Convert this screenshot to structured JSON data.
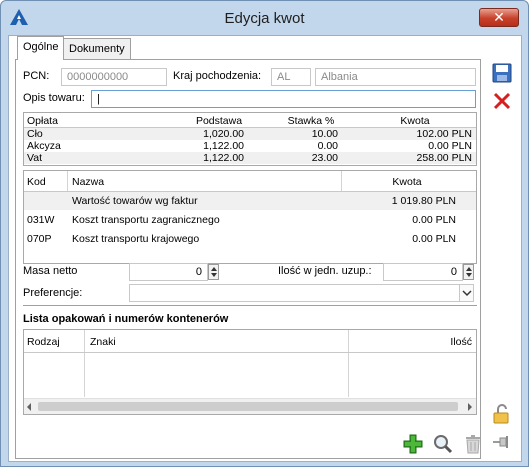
{
  "window": {
    "title": "Edycja kwot",
    "close_label": "✕"
  },
  "tabs": [
    {
      "label": "Ogólne",
      "active": true
    },
    {
      "label": "Dokumenty",
      "active": false
    }
  ],
  "form": {
    "pcn_label": "PCN:",
    "pcn_value": "0000000000",
    "country_label": "Kraj pochodzenia:",
    "country_code": "AL",
    "country_name": "Albania",
    "description_label": "Opis towaru:",
    "description_value": "|"
  },
  "fees": {
    "headers": [
      "Opłata",
      "Podstawa",
      "Stawka %",
      "Kwota"
    ],
    "rows": [
      {
        "name": "Cło",
        "base": "1,020.00",
        "rate": "10.00",
        "amount": "102.00 PLN"
      },
      {
        "name": "Akcyza",
        "base": "1,122.00",
        "rate": "0.00",
        "amount": "0.00 PLN"
      },
      {
        "name": "Vat",
        "base": "1,122.00",
        "rate": "23.00",
        "amount": "258.00 PLN"
      }
    ]
  },
  "costs": {
    "headers": [
      "Kod",
      "Nazwa",
      "Kwota"
    ],
    "rows": [
      {
        "code": "",
        "name": "Wartość towarów wg faktur",
        "amount": "1 019.80 PLN"
      },
      {
        "code": "031W",
        "name": "Koszt transportu zagranicznego",
        "amount": "0.00 PLN"
      },
      {
        "code": "070P",
        "name": "Koszt transportu krajowego",
        "amount": "0.00 PLN"
      }
    ]
  },
  "weight": {
    "label": "Masa netto",
    "value": "0"
  },
  "quantity": {
    "label": "Ilość w jedn. uzup.:",
    "value": "0"
  },
  "preference": {
    "label": "Preferencje:",
    "value": ""
  },
  "containers": {
    "title": "Lista opakowań i numerów kontenerów",
    "headers": [
      "Rodzaj",
      "Znaki",
      "Ilość"
    ]
  },
  "icons": {
    "save": "save-icon",
    "cancel": "cancel-icon",
    "lock": "lock-icon",
    "pin": "pin-icon",
    "add": "add-icon",
    "preview": "magnifier-icon",
    "delete": "trash-icon"
  },
  "colors": {
    "frame": "#c3d7ec",
    "close_button": "#c7402a",
    "cancel_red": "#d42020",
    "add_green": "#3a9a2a",
    "row_alt": "#f0f0f0"
  }
}
